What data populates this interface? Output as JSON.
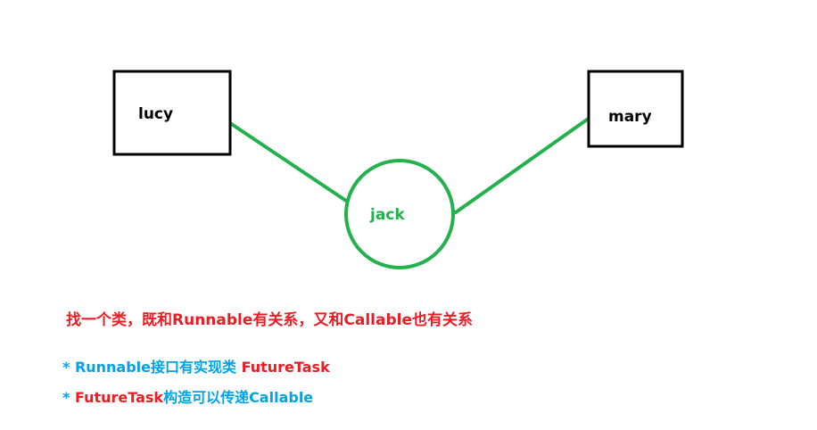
{
  "colors": {
    "box_border": "#000000",
    "connector": "#22b14c",
    "jack_text": "#22b14c",
    "red_text": "#ed1c24",
    "blue_text": "#00a2e8",
    "black_text": "#000000"
  },
  "nodes": {
    "lucy": {
      "label": "lucy"
    },
    "mary": {
      "label": "mary"
    },
    "jack": {
      "label": "jack"
    }
  },
  "notes": {
    "main": "找一个类，既和Runnable有关系，又和Callable也有关系",
    "line1": {
      "prefix": "* Runnable接口有实现类 ",
      "highlight": "FutureTask"
    },
    "line2": {
      "prefix": "* ",
      "highlight": "FutureTask",
      "suffix": "构造可以传递Callable"
    }
  }
}
